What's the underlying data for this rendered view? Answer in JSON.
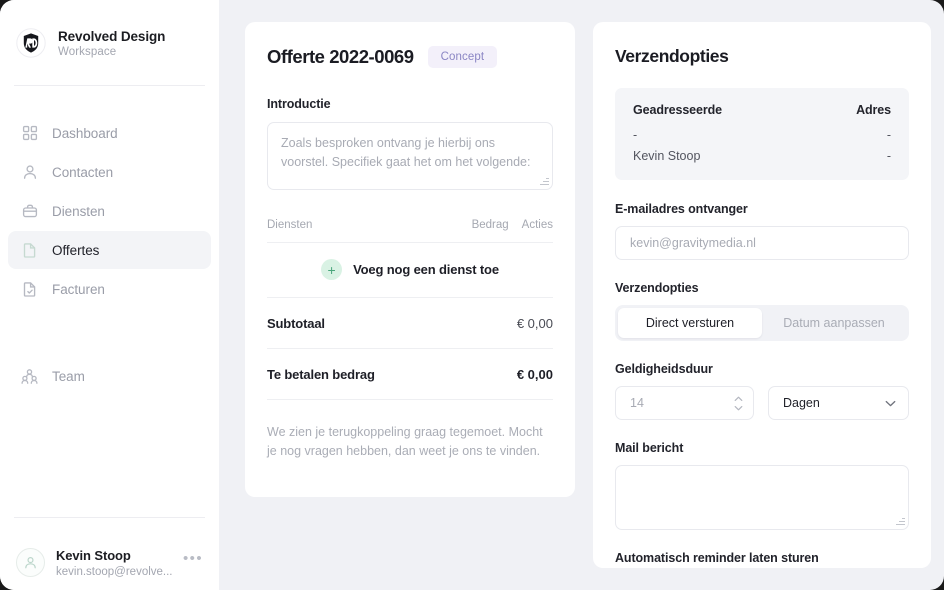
{
  "workspace": {
    "name": "Revolved Design",
    "subtitle": "Workspace",
    "logo_icon": "shield-monogram-icon"
  },
  "sidebar": {
    "items": [
      {
        "label": "Dashboard",
        "icon": "grid-icon",
        "active": false
      },
      {
        "label": "Contacten",
        "icon": "user-icon",
        "active": false
      },
      {
        "label": "Diensten",
        "icon": "briefcase-icon",
        "active": false
      },
      {
        "label": "Offertes",
        "icon": "document-icon",
        "active": true
      },
      {
        "label": "Facturen",
        "icon": "invoice-check-icon",
        "active": false
      }
    ],
    "team": {
      "label": "Team",
      "icon": "people-group-icon"
    },
    "user": {
      "name": "Kevin Stoop",
      "email": "kevin.stoop@revolve...",
      "avatar_icon": "user-avatar-icon",
      "more_icon": "ellipsis-icon"
    }
  },
  "offer": {
    "title": "Offerte 2022-0069",
    "status_badge": "Concept",
    "intro_label": "Introductie",
    "intro_placeholder": "Zoals besproken ontvang je hierbij ons voorstel. Specifiek gaat het om het volgende:",
    "table": {
      "col_diensten": "Diensten",
      "col_bedrag": "Bedrag",
      "col_acties": "Acties",
      "add_label": "Voeg nog een dienst toe",
      "add_icon": "plus-icon"
    },
    "totals": [
      {
        "label": "Subtotaal",
        "value": "€ 0,00"
      },
      {
        "label": "Te betalen bedrag",
        "value": "€ 0,00"
      }
    ],
    "footer_note": "We zien je terugkoppeling graag tegemoet. Mocht je nog vragen hebben, dan weet je ons te vinden."
  },
  "shipping": {
    "title": "Verzendopties",
    "recipient": {
      "col_geadresseerde": "Geadresseerde",
      "col_adres": "Adres",
      "rows": [
        {
          "name": "-",
          "address": "-"
        },
        {
          "name": "Kevin Stoop",
          "address": "-"
        }
      ]
    },
    "email": {
      "label": "E-mailadres ontvanger",
      "placeholder": "kevin@gravitymedia.nl"
    },
    "send_options": {
      "label": "Verzendopties",
      "options": [
        "Direct versturen",
        "Datum aanpassen"
      ],
      "selected": "Direct versturen"
    },
    "validity": {
      "label": "Geldigheidsduur",
      "amount_placeholder": "14",
      "unit_selected": "Dagen",
      "spinner_icon": "spinner-up-down-icon",
      "chevron_icon": "chevron-down-icon"
    },
    "mail_message": {
      "label": "Mail bericht",
      "value": ""
    },
    "reminder_label": "Automatisch reminder laten sturen"
  },
  "colors": {
    "page_background": "#f0f1f5",
    "card_background": "#ffffff",
    "badge_text": "#8b86c4",
    "badge_background": "#f3f0fa",
    "accent_mint": "#d9f2e4",
    "accent_mint_fg": "#4aa67c",
    "text_primary": "#1b1c23",
    "text_muted": "#a3a6b0"
  }
}
